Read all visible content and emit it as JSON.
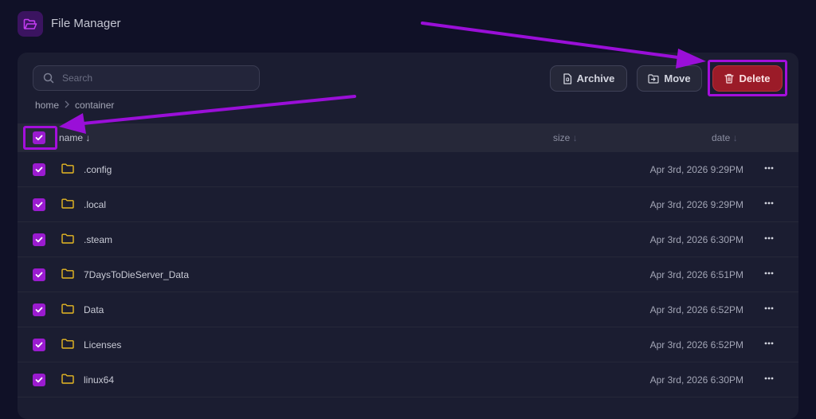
{
  "app": {
    "title": "File Manager"
  },
  "search": {
    "placeholder": "Search"
  },
  "toolbar": {
    "archive_label": "Archive",
    "move_label": "Move",
    "delete_label": "Delete"
  },
  "breadcrumb": [
    "home",
    "container"
  ],
  "table": {
    "columns": {
      "name": "name",
      "size": "size",
      "date": "date"
    },
    "rows": [
      {
        "name": ".config",
        "date": "Apr 3rd, 2026 9:29PM"
      },
      {
        "name": ".local",
        "date": "Apr 3rd, 2026 9:29PM"
      },
      {
        "name": ".steam",
        "date": "Apr 3rd, 2026 6:30PM"
      },
      {
        "name": "7DaysToDieServer_Data",
        "date": "Apr 3rd, 2026 6:51PM"
      },
      {
        "name": "Data",
        "date": "Apr 3rd, 2026 6:52PM"
      },
      {
        "name": "Licenses",
        "date": "Apr 3rd, 2026 6:52PM"
      },
      {
        "name": "linux64",
        "date": "Apr 3rd, 2026 6:30PM"
      }
    ]
  },
  "colors": {
    "accent": "#9b1bd0",
    "delete": "#9b1b28",
    "highlight": "#a40fdc",
    "folder": "#e8b923"
  }
}
